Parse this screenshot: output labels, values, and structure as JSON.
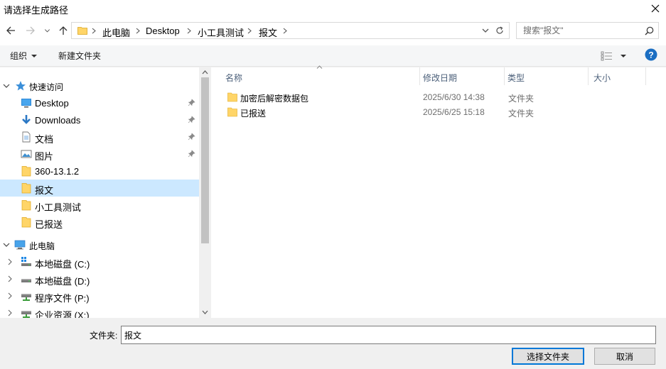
{
  "window": {
    "title": "请选择生成路径"
  },
  "address": {
    "breadcrumbs": [
      "此电脑",
      "Desktop",
      "小工具测试",
      "报文"
    ]
  },
  "search": {
    "placeholder": "搜索\"报文\""
  },
  "toolbar": {
    "organize": "组织",
    "new_folder": "新建文件夹"
  },
  "nav": {
    "quick_access": "快速访问",
    "items": [
      {
        "label": "Desktop",
        "icon": "desktop-icon",
        "pinned": true
      },
      {
        "label": "Downloads",
        "icon": "download-icon",
        "pinned": true
      },
      {
        "label": "文档",
        "icon": "document-icon",
        "pinned": true
      },
      {
        "label": "图片",
        "icon": "picture-icon",
        "pinned": true
      },
      {
        "label": "360-13.1.2",
        "icon": "folder-icon",
        "pinned": false
      },
      {
        "label": "报文",
        "icon": "folder-icon",
        "pinned": false,
        "selected": true
      },
      {
        "label": "小工具测试",
        "icon": "folder-icon",
        "pinned": false
      },
      {
        "label": "已报送",
        "icon": "folder-icon",
        "pinned": false
      }
    ],
    "this_pc": "此电脑",
    "drives": [
      {
        "label": "本地磁盘 (C:)",
        "icon": "system-drive-icon"
      },
      {
        "label": "本地磁盘 (D:)",
        "icon": "drive-icon"
      },
      {
        "label": "程序文件 (P:)",
        "icon": "network-drive-icon"
      },
      {
        "label": "企业资源 (X:)",
        "icon": "network-drive-icon"
      }
    ]
  },
  "columns": {
    "name": "名称",
    "modified": "修改日期",
    "type": "类型",
    "size": "大小"
  },
  "files": [
    {
      "name": "加密后解密数据包",
      "modified": "2025/6/30 14:38",
      "type": "文件夹"
    },
    {
      "name": "已报送",
      "modified": "2025/6/25 15:18",
      "type": "文件夹"
    }
  ],
  "footer": {
    "folder_label": "文件夹:",
    "folder_value": "报文",
    "select_button": "选择文件夹",
    "cancel_button": "取消"
  },
  "colors": {
    "selection": "#cce8ff",
    "accent": "#0078d7",
    "folder": "#ffd568"
  }
}
